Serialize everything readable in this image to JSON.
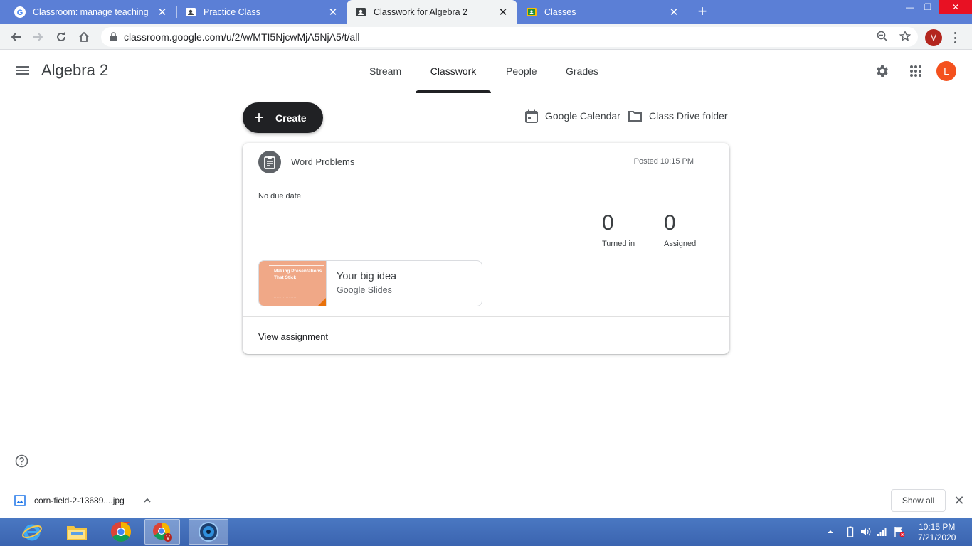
{
  "browser": {
    "tabs": [
      {
        "title": "Classroom: manage teaching and",
        "active": false
      },
      {
        "title": "Practice Class",
        "active": false
      },
      {
        "title": "Classwork for Algebra 2",
        "active": true
      },
      {
        "title": "Classes",
        "active": false
      }
    ],
    "new_tab_label": "+",
    "close_glyph": "✕",
    "url": "classroom.google.com/u/2/w/MTI5NjcwMjA5NjA5/t/all",
    "profile_initial": "V"
  },
  "classroom": {
    "class_name": "Algebra 2",
    "nav_tabs": [
      "Stream",
      "Classwork",
      "People",
      "Grades"
    ],
    "active_tab": "Classwork",
    "avatar_initial": "L",
    "avatar_color": "#f4511e"
  },
  "classwork": {
    "create_label": "Create",
    "calendar_label": "Google Calendar",
    "drive_label": "Class Drive folder",
    "assignment": {
      "title": "Word Problems",
      "posted": "Posted 10:15 PM",
      "due": "No due date",
      "turned_in_count": "0",
      "turned_in_label": "Turned in",
      "assigned_count": "0",
      "assigned_label": "Assigned",
      "attachment": {
        "name": "Your big idea",
        "type": "Google Slides",
        "thumb_title": "Making Presentations That Stick",
        "thumb_color": "#f0a887"
      },
      "view_label": "View assignment"
    }
  },
  "downloads": {
    "file_name": "corn-field-2-13689....jpg",
    "show_all_label": "Show all"
  },
  "taskbar": {
    "time": "10:15 PM",
    "date": "7/21/2020"
  }
}
